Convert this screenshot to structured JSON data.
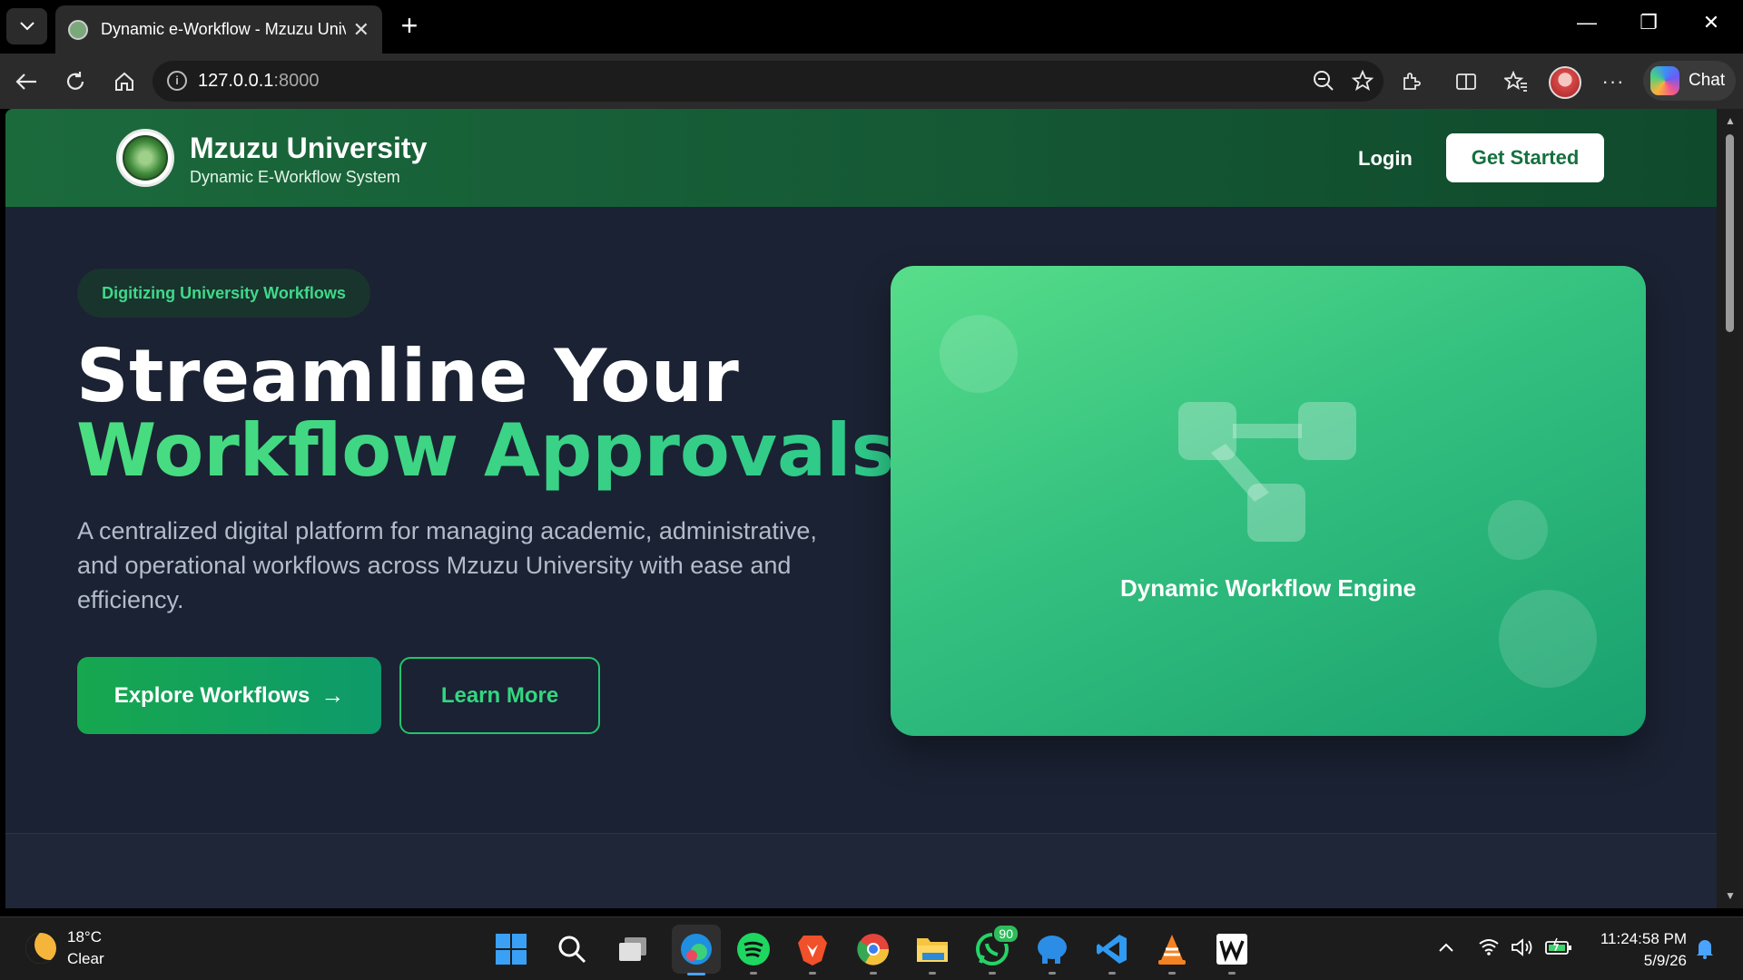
{
  "browser": {
    "tab_title": "Dynamic e-Workflow - Mzuzu Univ",
    "url_host": "127.0.0.1",
    "url_port": ":8000",
    "chat_label": "Chat"
  },
  "header": {
    "brand_name": "Mzuzu University",
    "brand_subtitle": "Dynamic E-Workflow System",
    "login_label": "Login",
    "get_started_label": "Get Started"
  },
  "hero": {
    "badge": "Digitizing University Workflows",
    "headline_line1": "Streamline Your",
    "headline_line2": "Workflow Approvals",
    "description": "A centralized digital platform for managing academic, administrative, and operational workflows across Mzuzu University with ease and efficiency.",
    "primary_button": "Explore Workflows",
    "secondary_button": "Learn More",
    "card_label": "Dynamic Workflow Engine"
  },
  "colors": {
    "header_green": "#1b6a3c",
    "accent_green": "#34d67f",
    "page_bg": "#1b2233"
  },
  "taskbar": {
    "temperature": "18°C",
    "weather": "Clear",
    "time": "11:24:58 PM",
    "date": "5/9/26",
    "whatsapp_badge": "90",
    "apps": [
      "windows-start",
      "search",
      "task-view",
      "edge",
      "spotify",
      "brave",
      "chrome",
      "file-explorer",
      "whatsapp",
      "elephant-app",
      "vscode",
      "vlc",
      "notion-like-app"
    ]
  }
}
